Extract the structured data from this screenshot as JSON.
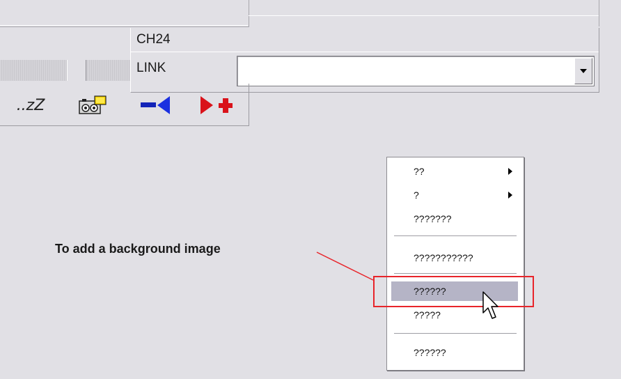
{
  "dialog": {
    "channel_label": "CH24",
    "link_label": "LINK",
    "link_value": ""
  },
  "toolbar": {
    "sleep_label": "..zZ",
    "buttons": [
      "sleep",
      "camera",
      "back",
      "forward-add"
    ]
  },
  "callout": {
    "text": "To add a background image"
  },
  "context_menu": {
    "items": [
      {
        "label": "??",
        "submenu": true
      },
      {
        "label": "?",
        "submenu": true
      },
      {
        "label": "???????",
        "submenu": false
      },
      {
        "label": "???????????",
        "submenu": false
      },
      {
        "label": "??????",
        "submenu": false,
        "selected": true
      },
      {
        "label": "?????",
        "submenu": false
      },
      {
        "label": "??????",
        "submenu": false
      }
    ]
  },
  "colors": {
    "background": "#e1e0e5",
    "highlight_box": "#e8242a",
    "selected_item": "#b5b4c6",
    "callout_line": "#e8242a"
  }
}
